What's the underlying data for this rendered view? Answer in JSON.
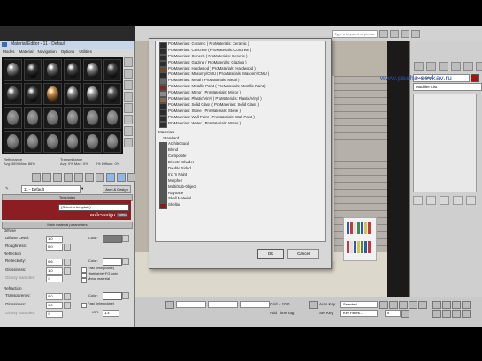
{
  "material_editor": {
    "title": "Material Editor - 11 - Default",
    "menu": [
      "Modes",
      "Material",
      "Navigation",
      "Options",
      "Utilities"
    ],
    "reflectance_label": "Reflectance",
    "reflectance_values": "Avg: 38% Max: 86%",
    "transmittance_label": "Transmittance",
    "transmittance_values": "Avg: 0% Max: 0%",
    "diffuse_values": "0% Diffuse: 0%",
    "material_name": "11 - Default",
    "arch_design_button": "Arch & Design",
    "templates_rollout": "Templates",
    "template_select": "(Select a template)",
    "logo_text": "arch-design",
    "logo_tag": "mental ray",
    "main_params_rollout": "Main material parameters",
    "diffuse": {
      "group": "Diffuse",
      "level_label": "Diffuse Level:",
      "level_value": "1,0",
      "color_label": "Color:",
      "roughness_label": "Roughness:",
      "roughness_value": "0,0"
    },
    "reflection": {
      "group": "Reflection",
      "reflectivity_label": "Reflectivity:",
      "reflectivity_value": "0,6",
      "color_label": "Color:",
      "glossiness_label": "Glossiness:",
      "glossiness_value": "1,0",
      "glossy_samples_label": "Glossy Samples:",
      "glossy_samples_value": "8",
      "fast_interp": "Fast (interpolate)",
      "highlights_fr": "Highlights+FG only",
      "metal_material": "Metal material"
    },
    "refraction": {
      "group": "Refraction",
      "transparency_label": "Transparency:",
      "transparency_value": "0,0",
      "color_label": "Color:",
      "glossiness_label": "Glossiness:",
      "glossiness_value": "1,0",
      "fast_interp": "Fast (interpolate)",
      "glossy_samples_label": "Glossy Samples:",
      "glossy_samples_value": "8",
      "ior_label": "IOR:",
      "ior_value": "1,4"
    }
  },
  "browser": {
    "autodesk_items": [
      "ProMaterials: Ceramic ( ProMaterials: Ceramic )",
      "ProMaterials: Concrete ( ProMaterials: Concrete )",
      "ProMaterials: Generic ( ProMaterials: Generic )",
      "ProMaterials: Glazing ( ProMaterials: Glazing )",
      "ProMaterials: Hardwood ( ProMaterials: Hardwood )",
      "ProMaterials: Masonry/CMU ( ProMaterials: Masonry/CMU )",
      "ProMaterials: Metal ( ProMaterials: Metal )",
      "ProMaterials: Metallic Paint ( ProMaterials: Metallic Paint )",
      "ProMaterials: Mirror ( ProMaterials: Mirror )",
      "ProMaterials: Plastic/Vinyl ( ProMaterials: Plastic/Vinyl )",
      "ProMaterials: Solid Glass ( ProMaterials: Solid Glass )",
      "ProMaterials: Stone ( ProMaterials: Stone )",
      "ProMaterials: Wall Paint ( ProMaterials: Wall Paint )",
      "ProMaterials: Water ( ProMaterials: Water )"
    ],
    "materials_section": "Materials",
    "standard_section": "Standard",
    "standard_items": [
      "Architectural",
      "Blend",
      "Composite",
      "DirectX Shader",
      "Double Sided",
      "Ink 'n Paint",
      "Morpher",
      "Multi/Sub-Object",
      "Raytrace",
      "Shell Material",
      "Shellac"
    ],
    "ok_label": "OK",
    "cancel_label": "Cancel"
  },
  "top_bar": {
    "search_placeholder": "Type a keyword or phrase"
  },
  "watermark": "www.pasha-sevkav.ru",
  "command_panel": {
    "object_name": "Group01",
    "modifier_list": "Modifier List"
  },
  "status": {
    "grid": "Grid = 10,0",
    "auto_key": "Auto Key",
    "set_key": "Set Key",
    "selected": "Selected",
    "key_filters": "Key Filters...",
    "add_time_tag": "Add Time Tag",
    "frame": "0"
  }
}
